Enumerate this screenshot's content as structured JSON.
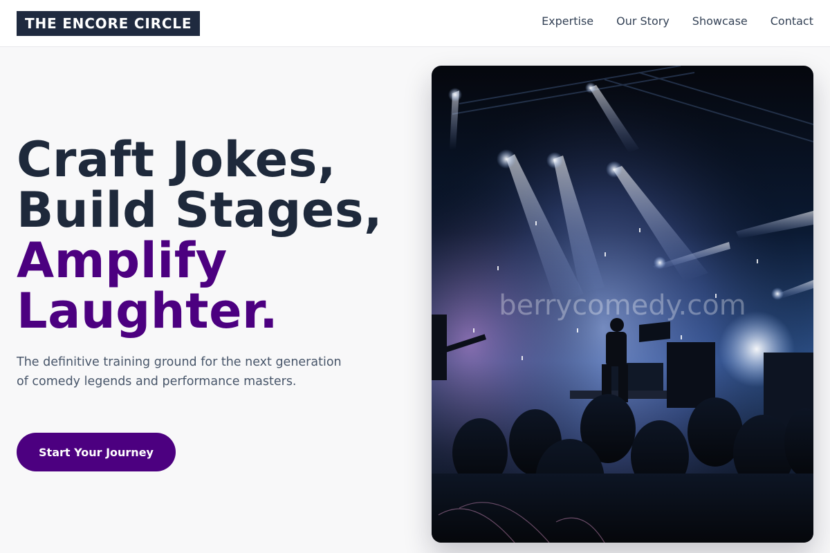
{
  "header": {
    "logo": "THE ENCORE CIRCLE",
    "nav": [
      "Expertise",
      "Our Story",
      "Showcase",
      "Contact"
    ]
  },
  "hero": {
    "headline_lines": [
      "Craft Jokes,",
      "Build Stages,",
      "Amplify",
      "Laughter."
    ],
    "subtitle": "The definitive training ground for the next generation of comedy legends and performance masters.",
    "cta_label": "Start Your Journey",
    "image_watermark": "berrycomedy.com"
  },
  "colors": {
    "accent": "#4c0080",
    "dark": "#1e293b",
    "logo_bg": "#1f2a3f"
  }
}
